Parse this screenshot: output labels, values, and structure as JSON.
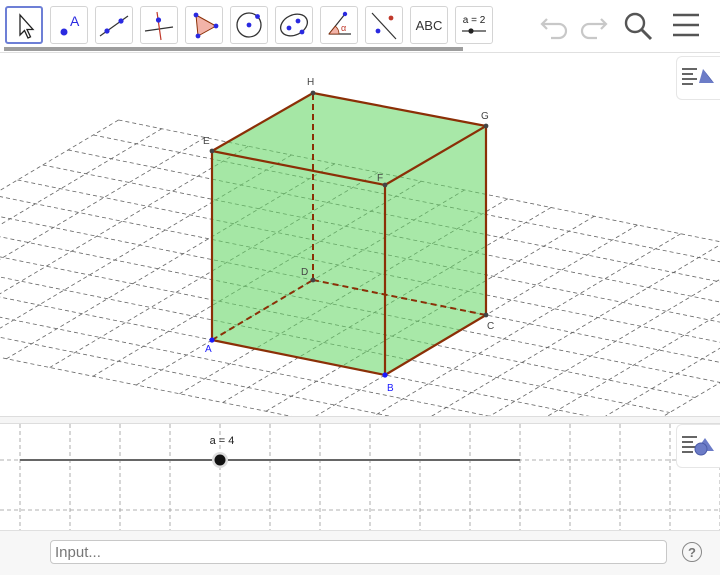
{
  "toolbar": {
    "tools": [
      {
        "name": "move-tool-icon"
      },
      {
        "name": "point-tool-icon",
        "label": "A"
      },
      {
        "name": "line-tool-icon"
      },
      {
        "name": "perpendicular-line-tool-icon"
      },
      {
        "name": "polygon-tool-icon"
      },
      {
        "name": "circle-tool-icon"
      },
      {
        "name": "ellipse-tool-icon"
      },
      {
        "name": "angle-tool-icon",
        "label": "α"
      },
      {
        "name": "reflect-tool-icon"
      },
      {
        "name": "text-tool-icon",
        "label": "ABC"
      },
      {
        "name": "slider-tool-icon",
        "label": "a = 2"
      }
    ],
    "actions": [
      {
        "name": "undo-icon"
      },
      {
        "name": "redo-icon"
      },
      {
        "name": "search-icon"
      },
      {
        "name": "menu-icon"
      }
    ]
  },
  "graphics3d": {
    "points": [
      "A",
      "B",
      "C",
      "D",
      "E",
      "F",
      "G",
      "H"
    ],
    "style_button": "style-bar-3d-icon",
    "colors": {
      "face": "#66d666",
      "edge": "#8b2f06",
      "point": "#1a1aff",
      "grid": "#666666"
    }
  },
  "slider": {
    "label": "a = 4",
    "value": 4,
    "position_fraction": 0.4,
    "style_button": "style-bar-2d-icon"
  },
  "input": {
    "placeholder": "Input...",
    "help_label": "?"
  }
}
